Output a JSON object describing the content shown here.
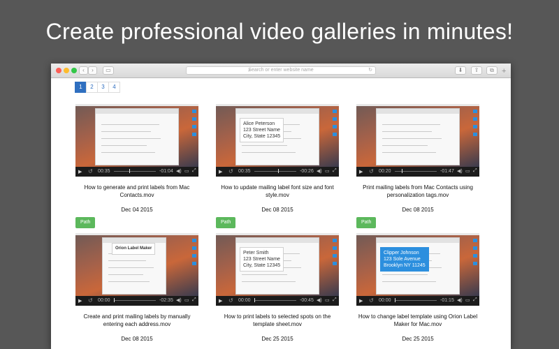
{
  "headline": "Create professional video galleries in minutes!",
  "browser": {
    "address_placeholder": "Search or enter website name",
    "back_glyph": "‹",
    "forward_glyph": "›",
    "sidebar_glyph": "▭",
    "reload_glyph": "↻",
    "download_glyph": "⬇",
    "share_glyph": "⇪",
    "tabs_glyph": "⧉",
    "new_tab_glyph": "+"
  },
  "pagination": [
    "1",
    "2",
    "3",
    "4"
  ],
  "pagination_active": "1",
  "videos": [
    {
      "title": "How to generate and print labels from Mac Contacts.mov",
      "date": "Dec 04 2015",
      "current_time": "00:35",
      "remaining": "-01:04",
      "progress": 0.36,
      "path_label": "Path"
    },
    {
      "title": "How to update mailing label font size and font style.mov",
      "date": "Dec 08 2015",
      "current_time": "00:35",
      "remaining": "-00:26",
      "progress": 0.57,
      "path_label": "Path",
      "overlay": "Alice Peterson\n123 Street Name\nCity, State 12345"
    },
    {
      "title": "Print mailing labels from Mac Contacts using personalization tags.mov",
      "date": "Dec 08 2015",
      "current_time": "00:20",
      "remaining": "-01:47",
      "progress": 0.16,
      "path_label": "Path"
    },
    {
      "title": "Create and print mailing labels by manually entering each address.mov",
      "date": "Dec 08 2015",
      "current_time": "00:00",
      "remaining": "-02:35",
      "progress": 0.0,
      "overlay": "Orion Label Maker"
    },
    {
      "title": "How to print labels to selected spots on the template sheet.mov",
      "date": "Dec 25 2015",
      "current_time": "00:00",
      "remaining": "-00:45",
      "progress": 0.0,
      "overlay": "Peter Smith\n123 Street Name\nCity, State 12345"
    },
    {
      "title": "How to change label template using Orion Label Maker for Mac.mov",
      "date": "Dec 25 2015",
      "current_time": "00:00",
      "remaining": "-01:15",
      "progress": 0.0,
      "overlay": "Clipper Johnson\n123 Sole Avenue\nBrooklyn NY 11245"
    }
  ],
  "player_glyphs": {
    "play": "▶",
    "replay": "↺",
    "volume": "◀)",
    "airplay": "▭",
    "fullscreen": "⤢"
  },
  "colors": {
    "accent_blue": "#2f6fc0",
    "path_green": "#5cb85c",
    "background": "#575757"
  }
}
